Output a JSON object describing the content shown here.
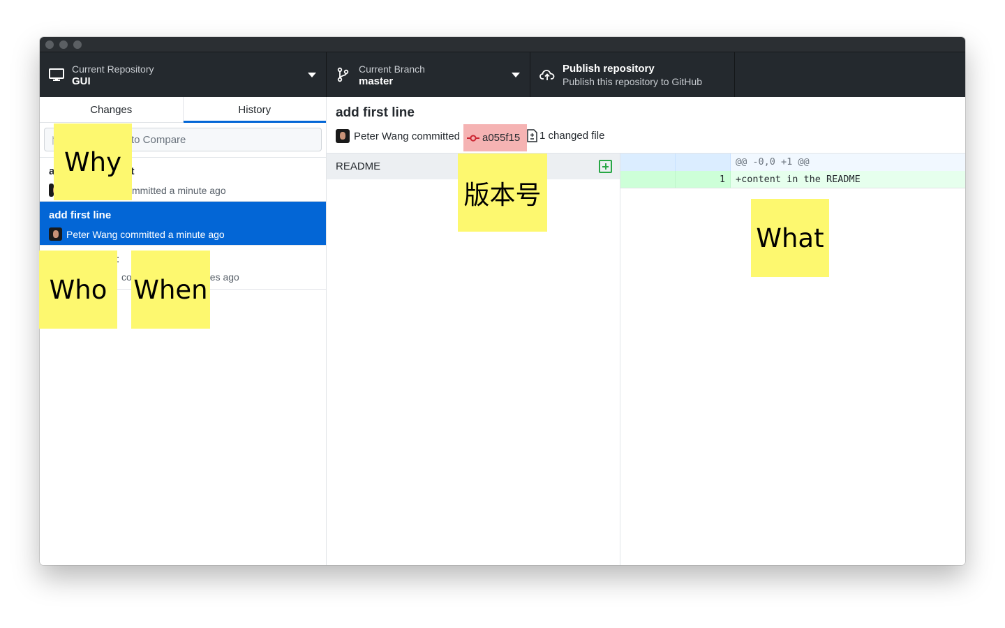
{
  "toolbar": {
    "repository": {
      "label": "Current Repository",
      "value": "GUI"
    },
    "branch": {
      "label": "Current Branch",
      "value": "master"
    },
    "publish": {
      "title": "Publish repository",
      "subtitle": "Publish this repository to GitHub"
    }
  },
  "sidebar": {
    "tabs": [
      {
        "label": "Changes",
        "selected": false
      },
      {
        "label": "History",
        "selected": true
      }
    ],
    "filter": {
      "placeholder_visible": "to Compare"
    },
    "commits": [
      {
        "summary_prefix": "a",
        "summary_suffix": "nt",
        "meta_visible": "mmitted a minute ago"
      },
      {
        "summary": "add first line",
        "meta": "Peter Wang committed a minute ago",
        "selected": true
      },
      {
        "summary_visible": ":",
        "meta_left_visible": "co",
        "meta_right_visible": "es ago"
      }
    ]
  },
  "commit_detail": {
    "title": "add first line",
    "author_meta": "Peter Wang committed",
    "sha": "a055f15",
    "changed_files": "1 changed file"
  },
  "files": [
    {
      "name": "README",
      "status": "added"
    }
  ],
  "diff": {
    "hunk_header": "@@ -0,0 +1 @@",
    "lines": [
      {
        "new_line_number": "1",
        "content": "+content in the README"
      }
    ]
  },
  "stickies": {
    "why": "Why",
    "version": "版本号",
    "what": "What",
    "who": "Who",
    "when": "When"
  },
  "colors": {
    "toolbar_bg": "#24292e",
    "selection_blue": "#0366d6",
    "sticky_yellow": "#fdf86f",
    "sha_highlight": "#f5b3b3",
    "added_green": "#28a745"
  }
}
